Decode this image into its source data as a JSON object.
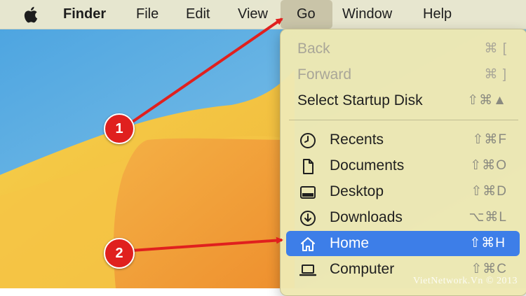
{
  "menubar": {
    "apple_icon": "apple-logo",
    "items": [
      {
        "label": "Finder",
        "bold": true
      },
      {
        "label": "File"
      },
      {
        "label": "Edit"
      },
      {
        "label": "View"
      },
      {
        "label": "Go",
        "active": true
      },
      {
        "label": "Window"
      },
      {
        "label": "Help"
      }
    ]
  },
  "go_menu": {
    "section1": [
      {
        "label": "Back",
        "shortcut": "⌘ [",
        "disabled": true
      },
      {
        "label": "Forward",
        "shortcut": "⌘ ]",
        "disabled": true
      },
      {
        "label": "Select Startup Disk",
        "shortcut": "⇧⌘▲"
      }
    ],
    "section2": [
      {
        "label": "Recents",
        "shortcut": "⇧⌘F",
        "icon": "clock-icon"
      },
      {
        "label": "Documents",
        "shortcut": "⇧⌘O",
        "icon": "document-icon"
      },
      {
        "label": "Desktop",
        "shortcut": "⇧⌘D",
        "icon": "desktop-icon"
      },
      {
        "label": "Downloads",
        "shortcut": "⌥⌘L",
        "icon": "download-icon"
      },
      {
        "label": "Home",
        "shortcut": "⇧⌘H",
        "icon": "home-icon",
        "selected": true
      },
      {
        "label": "Computer",
        "shortcut": "⇧⌘C",
        "icon": "computer-icon"
      }
    ]
  },
  "annotations": {
    "badge1": "1",
    "badge2": "2",
    "color": "#e0201e"
  },
  "watermark": "VietNetwork.Vn © 2013",
  "colors": {
    "menu_bg": "#eee8b2",
    "selection": "#3d7ee8",
    "menubar_bg": "#ece8ce"
  }
}
